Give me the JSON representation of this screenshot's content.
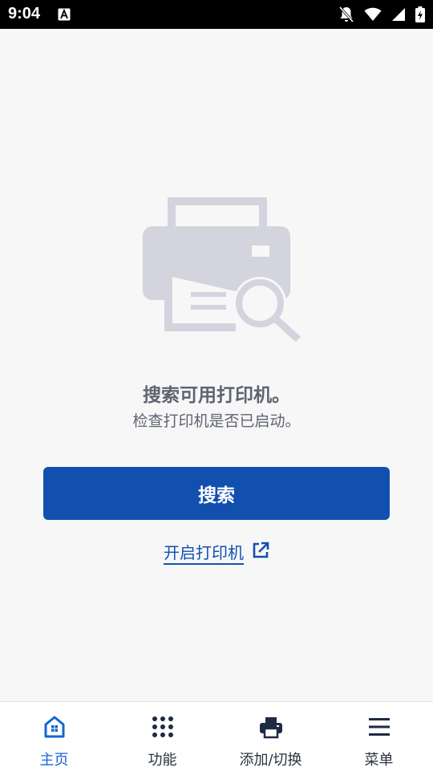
{
  "status_bar": {
    "time": "9:04",
    "icons": [
      "a-icon",
      "notifications-off-icon",
      "wifi-icon",
      "signal-icon",
      "battery-charging-icon"
    ]
  },
  "main": {
    "illustration_icon": "printer-search-icon",
    "title": "搜索可用打印机。",
    "subtitle": "检查打印机是否已启动。",
    "search_button": "搜索",
    "power_on_link": "开启打印机",
    "link_icon": "external-link-icon"
  },
  "bottom_nav": {
    "items": [
      {
        "label": "主页",
        "icon": "home-icon",
        "active": true
      },
      {
        "label": "功能",
        "icon": "grid-icon",
        "active": false
      },
      {
        "label": "添加/切换",
        "icon": "printer-icon",
        "active": false
      },
      {
        "label": "菜单",
        "icon": "menu-icon",
        "active": false
      }
    ]
  },
  "colors": {
    "accent": "#1250b0",
    "active_nav": "#1763d8",
    "illustration": "#d3d4de",
    "text_muted": "#5f6470"
  }
}
